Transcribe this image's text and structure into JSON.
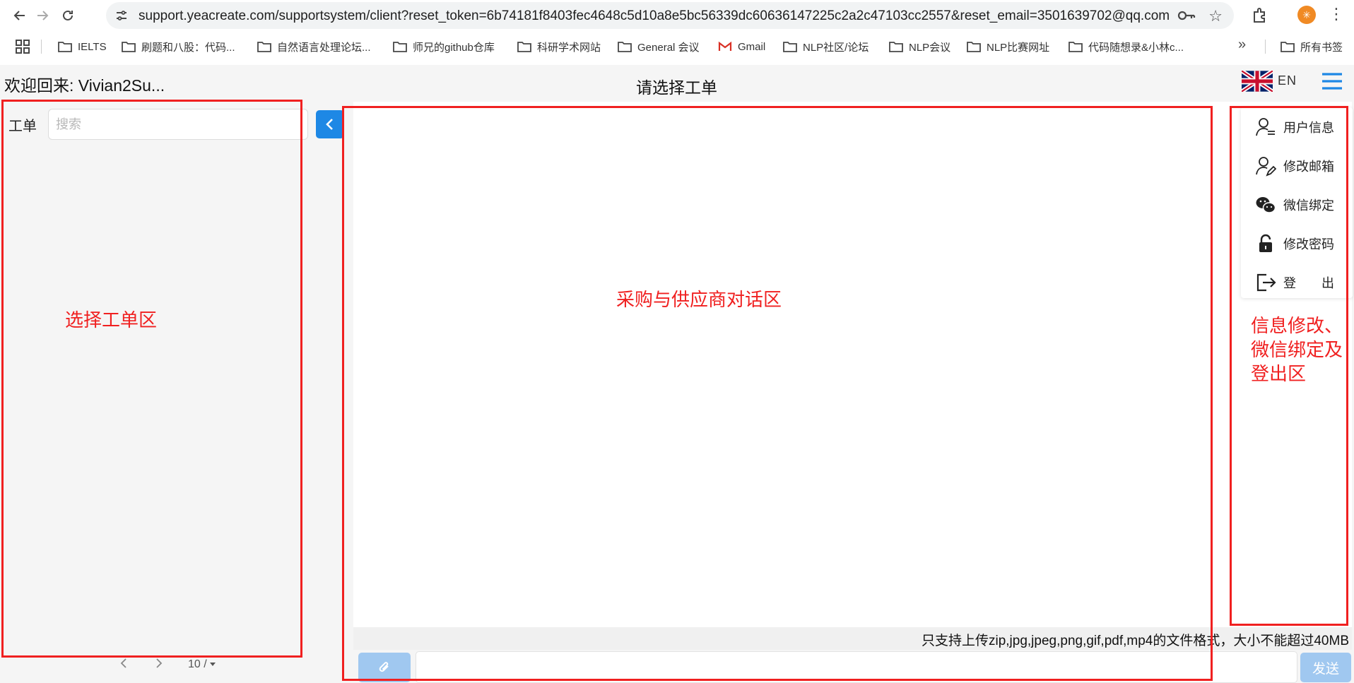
{
  "browser": {
    "url": "support.yeacreate.com/supportsystem/client?reset_token=6b74181f8403fec4648c5d10a8e5bc56339dc60636147225c2a2c47103cc2557&reset_email=3501639702@qq.com...",
    "profile_initial": "✳",
    "bookmarks": [
      "IELTS",
      "刷题和八股：代码...",
      "自然语言处理论坛...",
      "师兄的github仓库",
      "科研学术网站",
      "General 会议",
      "Gmail",
      "NLP社区/论坛",
      "NLP会议",
      "NLP比赛网址",
      "代码随想录&小林c..."
    ],
    "all_bookmarks": "所有书签"
  },
  "header": {
    "welcome": "欢迎回来: Vivian2Su...",
    "title": "请选择工单",
    "lang": "EN"
  },
  "left": {
    "ticket_label": "工单",
    "search_placeholder": "搜索",
    "pager_size": "10 /"
  },
  "chat": {
    "notice": "只支持上传zip,jpg,jpeg,png,gif,pdf,mp4的文件格式，大小不能超过40MB",
    "send": "发送"
  },
  "menu": {
    "items": [
      {
        "label": "用户信息",
        "icon": "user-info-icon"
      },
      {
        "label": "修改邮箱",
        "icon": "user-edit-icon"
      },
      {
        "label": "微信绑定",
        "icon": "wechat-icon"
      },
      {
        "label": "修改密码",
        "icon": "lock-icon"
      },
      {
        "label": "登　　出",
        "icon": "logout-icon"
      }
    ]
  },
  "annotations": {
    "left": "选择工单区",
    "center": "采购与供应商对话区",
    "right": "信息修改、\n微信绑定及\n登出区",
    "color": "#f02020"
  },
  "colors": {
    "primary": "#1e88e5",
    "disabled_primary": "#a0c8f0"
  }
}
